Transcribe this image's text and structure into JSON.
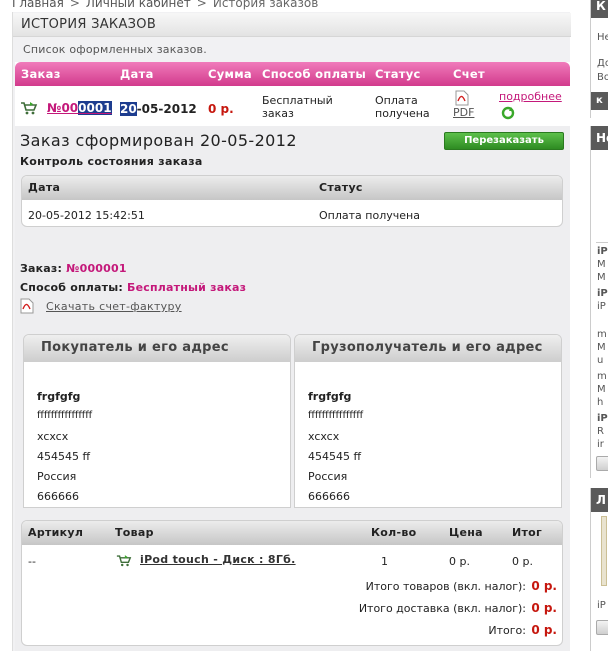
{
  "breadcrumb": [
    "Главная",
    "Личный кабинет",
    "История заказов"
  ],
  "breadcrumb_sep": ">",
  "page_title": "ИСТОРИЯ ЗАКАЗОВ",
  "subtitle": "Список оформленных заказов.",
  "orders_table": {
    "headers": [
      "Заказ",
      "Дата",
      "Сумма",
      "Способ оплаты",
      "Статус",
      "Счет"
    ],
    "row": {
      "order_prefix": "№00",
      "order_highlight": "0001",
      "date_highlight": "20",
      "date_rest": "-05-2012",
      "sum": "0 р.",
      "payment_line1": "Бесплатный",
      "payment_line2": "заказ",
      "status_line1": "Оплата",
      "status_line2": "получена",
      "invoice": "PDF",
      "details": "подробнее"
    }
  },
  "order": {
    "title": "Заказ сформирован 20-05-2012",
    "reorder_button": "Перезаказать",
    "status_section": "Контроль состояния заказа",
    "status_table": {
      "headers": [
        "Дата",
        "Статус"
      ],
      "row": [
        "20-05-2012 15:42:51",
        "Оплата получена"
      ]
    },
    "order_label": "Заказ:",
    "order_number": "№000001",
    "payment_label": "Способ оплаты:",
    "payment_value": "Бесплатный заказ",
    "invoice_link": "Скачать счет-фактуру",
    "buyer": {
      "title": "Покупатель и его адрес",
      "name": "frgfgfg",
      "lines": [
        "ffffffffffffffff",
        "xcxcx",
        "454545 ff",
        "Россия",
        "666666"
      ]
    },
    "consignee": {
      "title": "Грузополучатель и его адрес",
      "name": "frgfgfg",
      "lines": [
        "ffffffffffffffff",
        "xcxcx",
        "454545 ff",
        "Россия",
        "666666"
      ]
    },
    "goods": {
      "headers": [
        "Артикул",
        "Товар",
        "Кол-во",
        "Цена",
        "Итог"
      ],
      "row": {
        "article": "--",
        "product": "iPod touch - Диск : 8Гб.",
        "qty": "1",
        "price": "0 р.",
        "total": "0 р."
      },
      "totals": [
        {
          "label": "Итого товаров (вкл. налог):",
          "value": "0 р."
        },
        {
          "label": "Итого доставка (вкл. налог):",
          "value": "0 р."
        },
        {
          "label": "Итого:",
          "value": "0 р."
        }
      ]
    }
  },
  "right_column": {
    "block1_head": "К",
    "block1_lines": [
      "Не",
      "До",
      "Во"
    ],
    "block1_btn": "к",
    "block2_head": "Не",
    "block2_lines": [
      "iP",
      "M",
      "M",
      "iP",
      "iP",
      "m",
      "M",
      "u",
      "m",
      "M",
      "h",
      "iP",
      "R",
      "ir"
    ],
    "block3_head": "Л",
    "block3_lines": [
      "iP"
    ]
  },
  "colors": {
    "accent_pink": "#d23a8c",
    "link_pink": "#c4187a",
    "price_red": "#c6170e",
    "button_green": "#3a9a2c",
    "highlight_blue": "#1d3d8f"
  }
}
